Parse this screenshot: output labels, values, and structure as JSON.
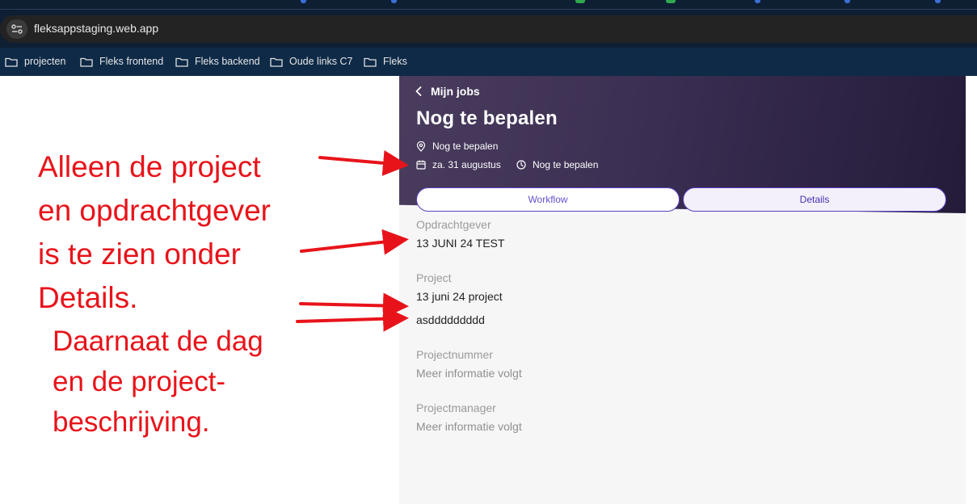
{
  "browser": {
    "url": "fleksappstaging.web.app",
    "bookmarks": [
      "projecten",
      "Fleks frontend",
      "Fleks backend",
      "Oude links C7",
      "Fleks"
    ]
  },
  "annotations": {
    "block1": [
      "Alleen de project",
      "en opdrachtgever",
      "is te zien onder",
      "Details."
    ],
    "block2": [
      "Daarnaat de dag",
      "en de project-",
      "beschrijving."
    ],
    "color": "#e8131a"
  },
  "job": {
    "back_label": "Mijn jobs",
    "title": "Nog te bepalen",
    "location": "Nog te bepalen",
    "date": "za. 31 augustus",
    "time": "Nog te bepalen"
  },
  "tabs": {
    "workflow": "Workflow",
    "details": "Details"
  },
  "details": {
    "opdrachtgever_label": "Opdrachtgever",
    "opdrachtgever_value": "13 JUNI 24 TEST",
    "project_label": "Project",
    "project_value": "13 juni 24 project",
    "project_description": "asddddddddd",
    "projectnummer_label": "Projectnummer",
    "projectnummer_value": "Meer informatie volgt",
    "projectmanager_label": "Projectmanager",
    "projectmanager_value": "Meer informatie volgt"
  },
  "colors": {
    "accent": "#5b3fc4",
    "hero_dark": "#241b39",
    "chrome": "#0e1f33"
  }
}
